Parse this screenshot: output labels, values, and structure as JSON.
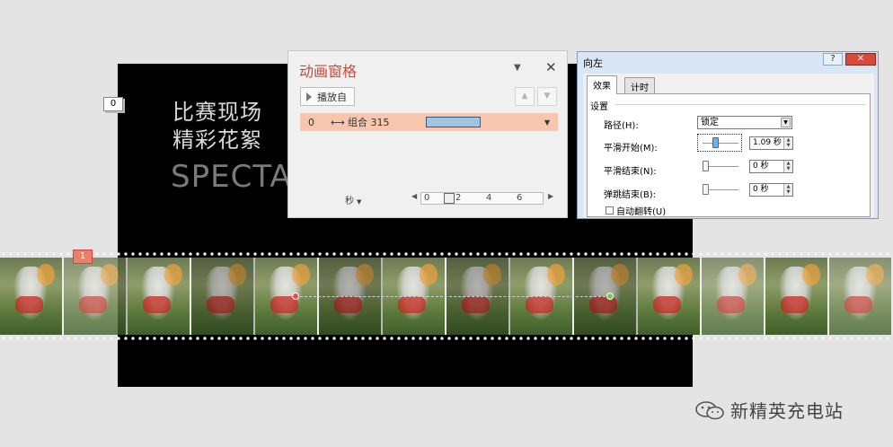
{
  "slide": {
    "tag": "0",
    "title_line1": "比赛现场",
    "title_line2": "精彩花絮",
    "subtitle": "SPECTA"
  },
  "film": {
    "frame_count": 14,
    "anim_marker": "1"
  },
  "animation_pane": {
    "title": "动画窗格",
    "play_label": "播放自",
    "item": {
      "index": "0",
      "arrow": "⟷",
      "name": "组合 315"
    },
    "seconds_label": "秒",
    "ticks": [
      "0",
      "2",
      "4",
      "6"
    ]
  },
  "effect_dialog": {
    "title": "向左",
    "help": "?",
    "close": "✕",
    "tabs": [
      "效果",
      "计时"
    ],
    "group": "设置",
    "path_label": "路径(H):",
    "path_value": "锁定",
    "smooth_start_label": "平滑开始(M):",
    "smooth_start_value": "1.09 秒",
    "smooth_end_label": "平滑结束(N):",
    "smooth_end_value": "0 秒",
    "bounce_end_label": "弹跳结束(B):",
    "bounce_end_value": "0 秒",
    "auto_reverse_label": "自动翻转(U)"
  },
  "watermark": {
    "text": "新精英充电站"
  },
  "colors": {
    "accent": "#c8493a",
    "selection": "#f8c6ad",
    "bar": "#a3c4dd"
  }
}
